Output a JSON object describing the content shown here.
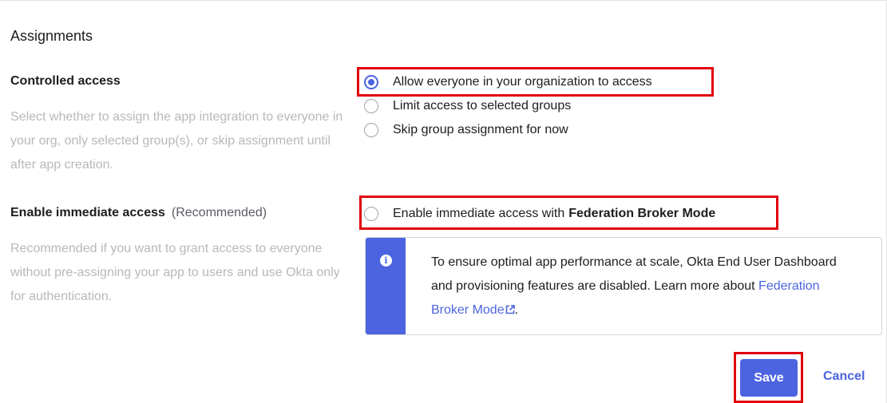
{
  "section": {
    "title": "Assignments"
  },
  "controlled_access": {
    "label": "Controlled access",
    "description": "Select whether to assign the app integration to everyone in your org, only selected group(s), or skip assignment until after app creation.",
    "options": [
      {
        "label": "Allow everyone in your organization to access",
        "checked": true
      },
      {
        "label": "Limit access to selected groups",
        "checked": false
      },
      {
        "label": "Skip group assignment for now",
        "checked": false
      }
    ]
  },
  "immediate_access": {
    "label": "Enable immediate access",
    "label_suffix": "(Recommended)",
    "description": "Recommended if you want to grant access to everyone without pre-assigning your app to users and use Okta only for authentication.",
    "checkbox_label": "Enable immediate access with",
    "checkbox_label_bold": "Federation Broker Mode",
    "checked": false
  },
  "callout": {
    "icon": "info-icon",
    "icon_glyph": "i",
    "text": "To ensure optimal app performance at scale, Okta End User Dashboard and provisioning features are disabled. Learn more about",
    "link_text": "Federation Broker Mode",
    "link_icon": "external-link-icon",
    "text_end": "."
  },
  "actions": {
    "save_label": "Save",
    "cancel_label": "Cancel"
  },
  "colors": {
    "accent": "#4c64e0",
    "highlight": "#e0000b"
  }
}
